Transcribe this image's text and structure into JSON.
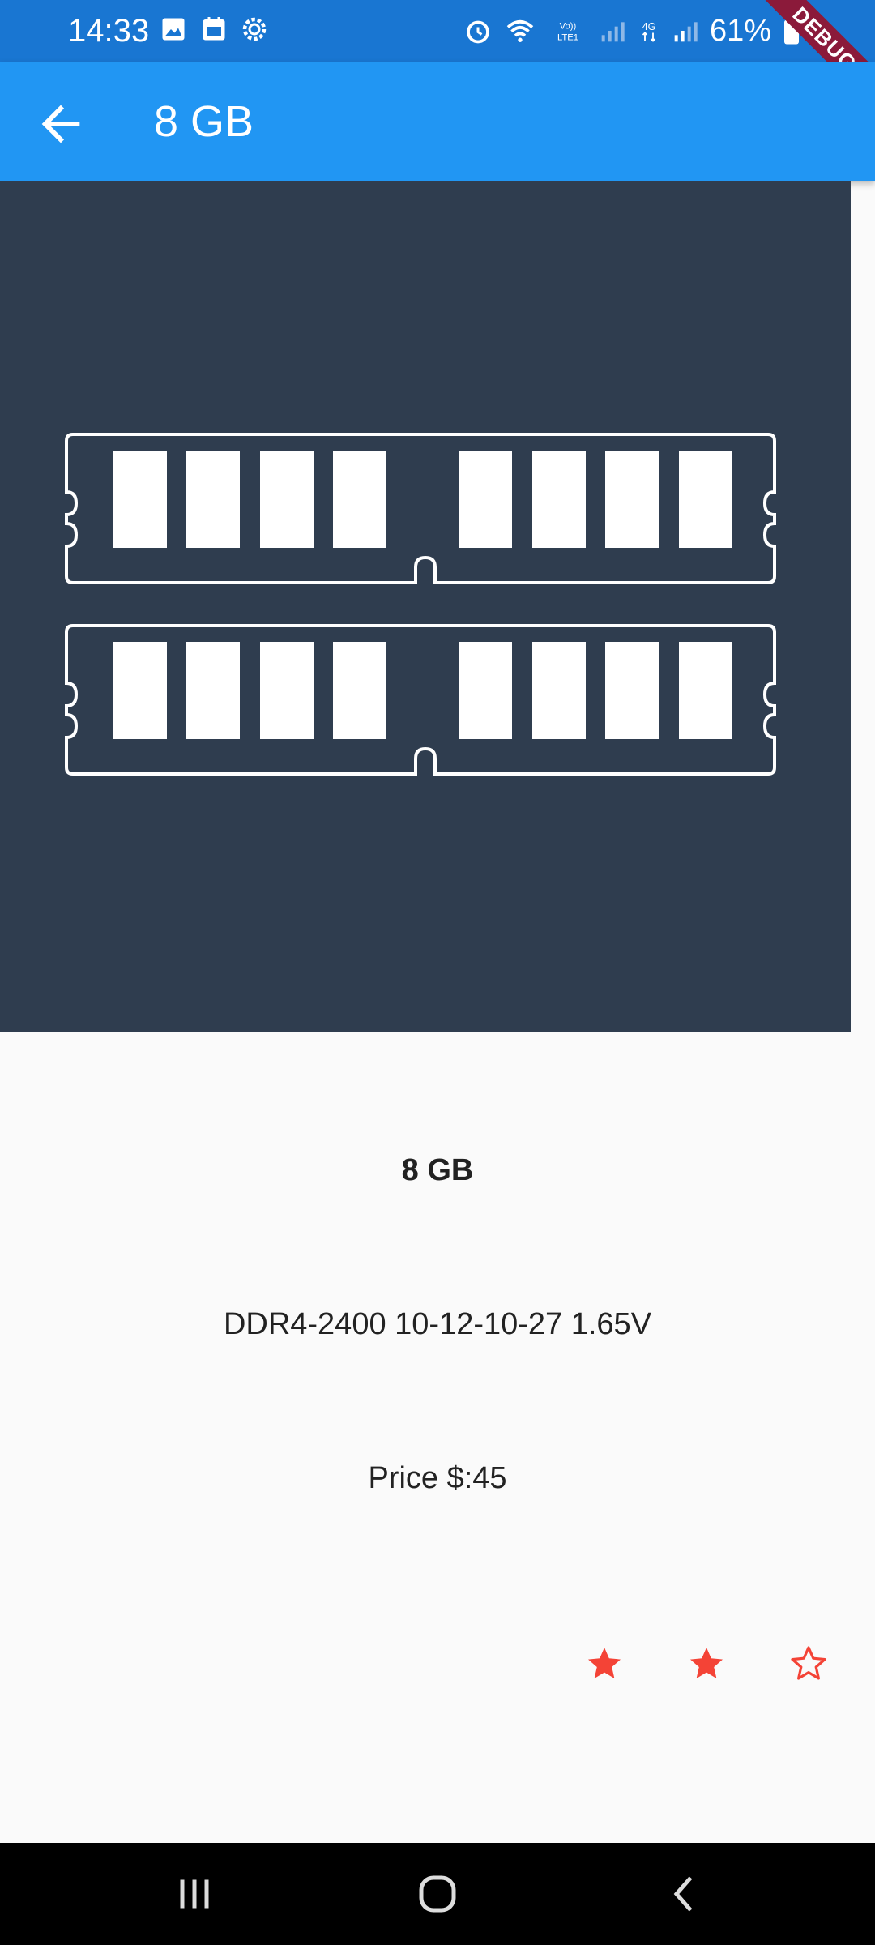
{
  "status_bar": {
    "time": "14:33",
    "battery": "61%",
    "network_labels": [
      "Vo))",
      "LTE1",
      "4G"
    ],
    "icons": [
      "image-icon",
      "calendar-icon",
      "settings-gear-icon",
      "alarm-icon",
      "wifi-icon",
      "signal-icon",
      "battery-icon"
    ]
  },
  "debug_banner": "DEBUG",
  "app_bar": {
    "title": "8 GB",
    "back_icon": "arrow-back-icon",
    "color": "#2196f3"
  },
  "hero": {
    "image_icon": "ram-module-icon",
    "background": "#2f3d4f"
  },
  "product": {
    "title": "8 GB",
    "spec": "DDR4-2400 10-12-10-27 1.65V",
    "price": "Price $:45",
    "rating": {
      "value": 2,
      "max": 3,
      "color": "#f44336"
    }
  },
  "nav_bar": {
    "icons": [
      "recent-apps-icon",
      "home-icon",
      "back-icon"
    ]
  }
}
